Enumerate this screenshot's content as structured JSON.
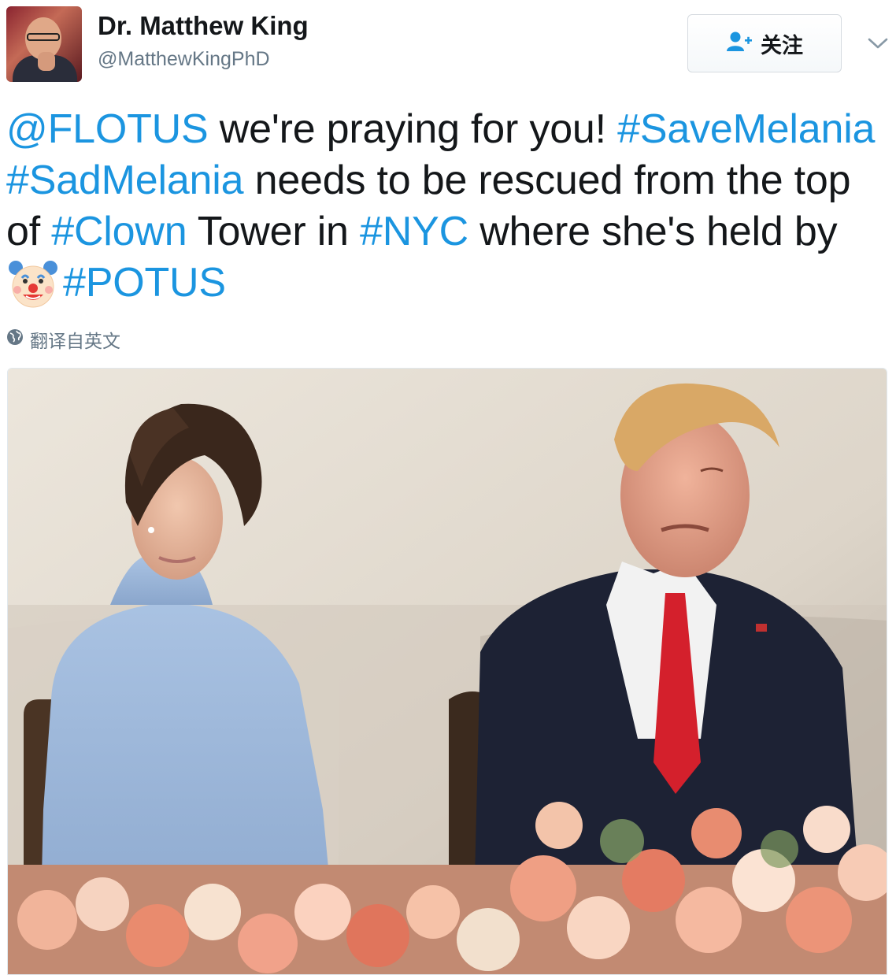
{
  "author": {
    "name": "Dr. Matthew King",
    "handle": "@MatthewKingPhD"
  },
  "follow_button": {
    "label": "关注",
    "icon": "add-user-icon"
  },
  "menu_icon": "chevron-down-icon",
  "tweet": {
    "line1": [
      "@FLOTUS",
      " we're praying for you! ",
      "#SaveMelania"
    ],
    "line2": [
      "#SadMelania",
      " needs to be rescued from the top"
    ],
    "line3": [
      "of ",
      "#Clown",
      " Tower in ",
      "#NYC",
      " where she's held by"
    ],
    "line4": [
      "#POTUS"
    ],
    "emoji": "clown-face-emoji"
  },
  "translate_label": "翻译自英文",
  "colors": {
    "link": "#1b95e0",
    "text": "#14171a",
    "secondary": "#657786"
  }
}
